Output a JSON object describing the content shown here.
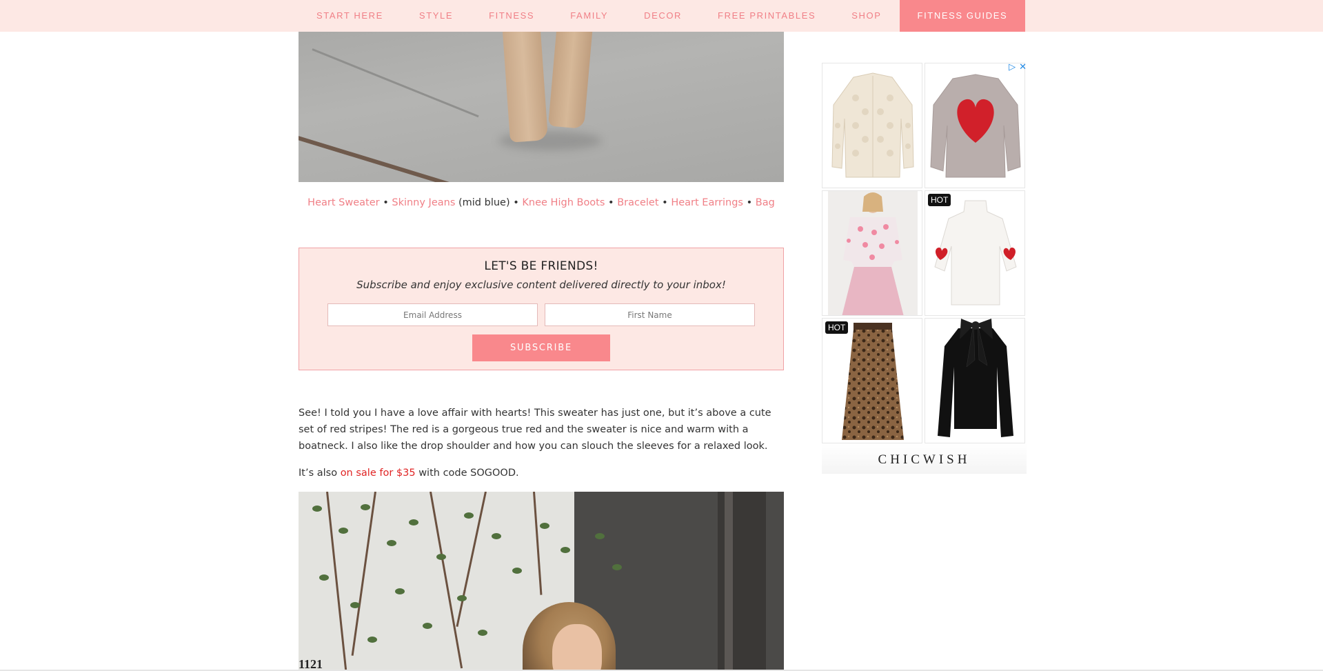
{
  "nav": {
    "items": [
      {
        "label": "START HERE"
      },
      {
        "label": "STYLE"
      },
      {
        "label": "FITNESS"
      },
      {
        "label": "FAMILY"
      },
      {
        "label": "DECOR"
      },
      {
        "label": "FREE PRINTABLES"
      },
      {
        "label": "SHOP"
      },
      {
        "label": "FITNESS GUIDES"
      }
    ]
  },
  "product_links": {
    "heart_sweater": "Heart Sweater",
    "skinny_jeans": "Skinny Jeans",
    "mid_blue": "(mid blue)",
    "knee_high_boots": "Knee High Boots",
    "bracelet": "Bracelet",
    "heart_earrings": "Heart Earrings",
    "bag": "Bag",
    "separator": "•"
  },
  "subscribe": {
    "title": "LET'S BE FRIENDS!",
    "tagline": "Subscribe and enjoy exclusive content delivered directly to your inbox!",
    "email_placeholder": "Email Address",
    "name_placeholder": "First Name",
    "button_label": "SUBSCRIBE"
  },
  "body": {
    "paragraph1": "See!  I told you I have a love affair with hearts!  This sweater has just one, but it’s above a cute set of red stripes!  The red is a gorgeous true red and the sweater is nice and warm with a boatneck. I also like the drop shoulder and how you can slouch the sleeves for a relaxed look.",
    "paragraph2_before": "It’s also ",
    "paragraph2_link": "on sale for $35",
    "paragraph2_after": " with code SOGOOD."
  },
  "photo_bottom": {
    "house_number": "1121"
  },
  "ad": {
    "play_icon": "▷",
    "close_icon": "✕",
    "hot_label": "HOT",
    "brand": "CHICWISH",
    "colors": {
      "accent": "#f9888c",
      "link": "#f07f86",
      "sale": "#e02424",
      "nav_bg": "#fde8e4"
    }
  }
}
